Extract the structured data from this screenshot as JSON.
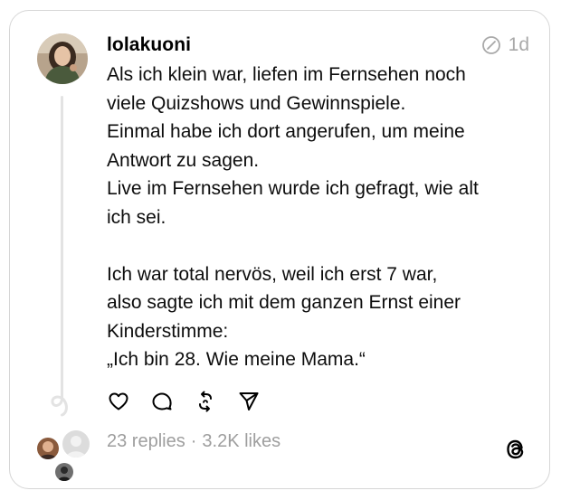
{
  "post": {
    "username": "lolakuoni",
    "time": "1d",
    "text": "Als ich klein war, liefen im Fernsehen noch\nviele Quizshows und Gewinnspiele.\nEinmal habe ich dort angerufen, um meine\nAntwort zu sagen.\nLive im Fernsehen wurde ich gefragt, wie alt\nich sei.\n\nIch war total nervös, weil ich erst 7 war,\nalso sagte ich mit dem ganzen Ernst einer\nKinderstimme:\n„Ich bin 28. Wie meine Mama.“",
    "replies": "23 replies",
    "separator": "·",
    "likes": "3.2K likes"
  },
  "actions": [
    {
      "name": "like",
      "icon": "heart-icon"
    },
    {
      "name": "reply",
      "icon": "comment-icon"
    },
    {
      "name": "repost",
      "icon": "repost-icon"
    },
    {
      "name": "share",
      "icon": "send-icon"
    }
  ],
  "colors": {
    "text": "#0d0d0d",
    "muted": "#9e9e9e",
    "border": "#d6d6d6",
    "thread_line": "#e3e3e3"
  }
}
